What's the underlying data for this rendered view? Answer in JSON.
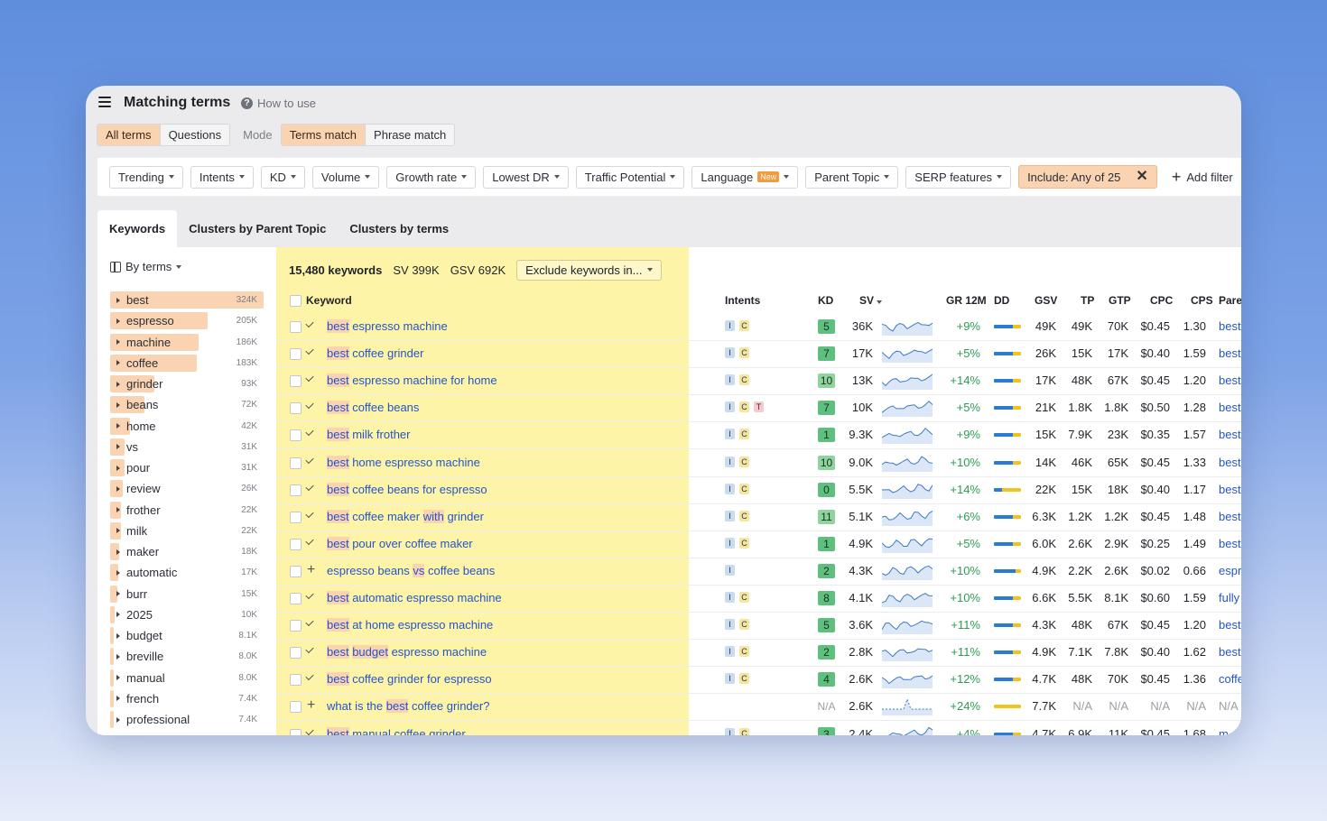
{
  "header": {
    "title": "Matching terms",
    "how_to_use": "How to use"
  },
  "modes": {
    "term_types": [
      "All terms",
      "Questions"
    ],
    "mode_label": "Mode",
    "match_types": [
      "Terms match",
      "Phrase match"
    ]
  },
  "filters": {
    "items": [
      "Trending",
      "Intents",
      "KD",
      "Volume",
      "Growth rate",
      "Lowest DR",
      "Traffic Potential",
      "Language",
      "Parent Topic",
      "SERP features"
    ],
    "new_badge": "New",
    "include": "Include: Any of 25",
    "add_filter": "Add filter"
  },
  "tabs": [
    "Keywords",
    "Clusters by Parent Topic",
    "Clusters by terms"
  ],
  "sidebar": {
    "by_terms": "By terms",
    "terms": [
      {
        "name": "best",
        "count": "324K",
        "share": 1.0
      },
      {
        "name": "espresso",
        "count": "205K",
        "share": 0.633
      },
      {
        "name": "machine",
        "count": "186K",
        "share": 0.574
      },
      {
        "name": "coffee",
        "count": "183K",
        "share": 0.565
      },
      {
        "name": "grinder",
        "count": "93K",
        "share": 0.287
      },
      {
        "name": "beans",
        "count": "72K",
        "share": 0.222
      },
      {
        "name": "home",
        "count": "42K",
        "share": 0.13
      },
      {
        "name": "vs",
        "count": "31K",
        "share": 0.096
      },
      {
        "name": "pour",
        "count": "31K",
        "share": 0.096
      },
      {
        "name": "review",
        "count": "26K",
        "share": 0.08
      },
      {
        "name": "frother",
        "count": "22K",
        "share": 0.068
      },
      {
        "name": "milk",
        "count": "22K",
        "share": 0.068
      },
      {
        "name": "maker",
        "count": "18K",
        "share": 0.056
      },
      {
        "name": "automatic",
        "count": "17K",
        "share": 0.052
      },
      {
        "name": "burr",
        "count": "15K",
        "share": 0.046
      },
      {
        "name": "2025",
        "count": "10K",
        "share": 0.031
      },
      {
        "name": "budget",
        "count": "8.1K",
        "share": 0.025
      },
      {
        "name": "breville",
        "count": "8.0K",
        "share": 0.025
      },
      {
        "name": "manual",
        "count": "8.0K",
        "share": 0.025
      },
      {
        "name": "french",
        "count": "7.4K",
        "share": 0.023
      },
      {
        "name": "professional",
        "count": "7.4K",
        "share": 0.023
      }
    ]
  },
  "summary": {
    "keywords": "15,480 keywords",
    "sv": "SV 399K",
    "gsv": "GSV 692K",
    "exclude": "Exclude keywords in..."
  },
  "table": {
    "columns": [
      "Keyword",
      "Intents",
      "KD",
      "SV",
      "GR 12M",
      "DD",
      "GSV",
      "TP",
      "GTP",
      "CPC",
      "CPS",
      "Pare"
    ],
    "rows": [
      {
        "parts": [
          [
            "best",
            1
          ],
          [
            " espresso machine",
            0
          ]
        ],
        "mark": "check",
        "intents": [
          "I",
          "C"
        ],
        "kd": "5",
        "kdc": "#5fbf7f",
        "sv": "36K",
        "gr": "+9%",
        "dd": 0.7,
        "gsv": "49K",
        "tp": "49K",
        "gtp": "70K",
        "cpc": "$0.45",
        "cps": "1.30",
        "parent": "best"
      },
      {
        "parts": [
          [
            "best",
            1
          ],
          [
            " coffee grinder",
            0
          ]
        ],
        "mark": "check",
        "intents": [
          "I",
          "C"
        ],
        "kd": "7",
        "kdc": "#5fbf7f",
        "sv": "17K",
        "gr": "+5%",
        "dd": 0.7,
        "gsv": "26K",
        "tp": "15K",
        "gtp": "17K",
        "cpc": "$0.40",
        "cps": "1.59",
        "parent": "best"
      },
      {
        "parts": [
          [
            "best",
            1
          ],
          [
            " espresso machine for home",
            0
          ]
        ],
        "mark": "check",
        "intents": [
          "I",
          "C"
        ],
        "kd": "10",
        "kdc": "#8fd39f",
        "sv": "13K",
        "gr": "+14%",
        "dd": 0.7,
        "gsv": "17K",
        "tp": "48K",
        "gtp": "67K",
        "cpc": "$0.45",
        "cps": "1.20",
        "parent": "best"
      },
      {
        "parts": [
          [
            "best",
            1
          ],
          [
            " coffee beans",
            0
          ]
        ],
        "mark": "check",
        "intents": [
          "I",
          "C",
          "T"
        ],
        "kd": "7",
        "kdc": "#5fbf7f",
        "sv": "10K",
        "gr": "+5%",
        "dd": 0.7,
        "gsv": "21K",
        "tp": "1.8K",
        "gtp": "1.8K",
        "cpc": "$0.50",
        "cps": "1.28",
        "parent": "best"
      },
      {
        "parts": [
          [
            "best",
            1
          ],
          [
            " milk frother",
            0
          ]
        ],
        "mark": "check",
        "intents": [
          "I",
          "C"
        ],
        "kd": "1",
        "kdc": "#5fbf7f",
        "sv": "9.3K",
        "gr": "+9%",
        "dd": 0.7,
        "gsv": "15K",
        "tp": "7.9K",
        "gtp": "23K",
        "cpc": "$0.35",
        "cps": "1.57",
        "parent": "best"
      },
      {
        "parts": [
          [
            "best",
            1
          ],
          [
            " home espresso machine",
            0
          ]
        ],
        "mark": "check",
        "intents": [
          "I",
          "C"
        ],
        "kd": "10",
        "kdc": "#8fd39f",
        "sv": "9.0K",
        "gr": "+10%",
        "dd": 0.7,
        "gsv": "14K",
        "tp": "46K",
        "gtp": "65K",
        "cpc": "$0.45",
        "cps": "1.33",
        "parent": "best"
      },
      {
        "parts": [
          [
            "best",
            1
          ],
          [
            " coffee beans for espresso",
            0
          ]
        ],
        "mark": "check",
        "intents": [
          "I",
          "C"
        ],
        "kd": "0",
        "kdc": "#5fbf7f",
        "sv": "5.5K",
        "gr": "+14%",
        "dd": 0.3,
        "gsv": "22K",
        "tp": "15K",
        "gtp": "18K",
        "cpc": "$0.40",
        "cps": "1.17",
        "parent": "best"
      },
      {
        "parts": [
          [
            "best",
            1
          ],
          [
            " coffee maker ",
            0
          ],
          [
            "with",
            1
          ],
          [
            " grinder",
            0
          ]
        ],
        "mark": "check",
        "intents": [
          "I",
          "C"
        ],
        "kd": "11",
        "kdc": "#8fd39f",
        "sv": "5.1K",
        "gr": "+6%",
        "dd": 0.7,
        "gsv": "6.3K",
        "tp": "1.2K",
        "gtp": "1.2K",
        "cpc": "$0.45",
        "cps": "1.48",
        "parent": "best"
      },
      {
        "parts": [
          [
            "best",
            1
          ],
          [
            " pour over coffee maker",
            0
          ]
        ],
        "mark": "check",
        "intents": [
          "I",
          "C"
        ],
        "kd": "1",
        "kdc": "#5fbf7f",
        "sv": "4.9K",
        "gr": "+5%",
        "dd": 0.7,
        "gsv": "6.0K",
        "tp": "2.6K",
        "gtp": "2.9K",
        "cpc": "$0.25",
        "cps": "1.49",
        "parent": "best"
      },
      {
        "parts": [
          [
            "espresso beans ",
            0
          ],
          [
            "vs",
            1
          ],
          [
            " coffee beans",
            0
          ]
        ],
        "mark": "plus",
        "intents": [
          "I"
        ],
        "kd": "2",
        "kdc": "#5fbf7f",
        "sv": "4.3K",
        "gr": "+10%",
        "dd": 0.8,
        "gsv": "4.9K",
        "tp": "2.2K",
        "gtp": "2.6K",
        "cpc": "$0.02",
        "cps": "0.66",
        "parent": "espr"
      },
      {
        "parts": [
          [
            "best",
            1
          ],
          [
            " automatic espresso machine",
            0
          ]
        ],
        "mark": "check",
        "intents": [
          "I",
          "C"
        ],
        "kd": "8",
        "kdc": "#5fbf7f",
        "sv": "4.1K",
        "gr": "+10%",
        "dd": 0.7,
        "gsv": "6.6K",
        "tp": "5.5K",
        "gtp": "8.1K",
        "cpc": "$0.60",
        "cps": "1.59",
        "parent": "fully"
      },
      {
        "parts": [
          [
            "best",
            1
          ],
          [
            " at home espresso machine",
            0
          ]
        ],
        "mark": "check",
        "intents": [
          "I",
          "C"
        ],
        "kd": "5",
        "kdc": "#5fbf7f",
        "sv": "3.6K",
        "gr": "+11%",
        "dd": 0.7,
        "gsv": "4.3K",
        "tp": "48K",
        "gtp": "67K",
        "cpc": "$0.45",
        "cps": "1.20",
        "parent": "best"
      },
      {
        "parts": [
          [
            "best",
            1
          ],
          [
            " ",
            0
          ],
          [
            "budget",
            1
          ],
          [
            " espresso machine",
            0
          ]
        ],
        "mark": "check",
        "intents": [
          "I",
          "C"
        ],
        "kd": "2",
        "kdc": "#5fbf7f",
        "sv": "2.8K",
        "gr": "+11%",
        "dd": 0.7,
        "gsv": "4.9K",
        "tp": "7.1K",
        "gtp": "7.8K",
        "cpc": "$0.40",
        "cps": "1.62",
        "parent": "best"
      },
      {
        "parts": [
          [
            "best",
            1
          ],
          [
            " coffee grinder for espresso",
            0
          ]
        ],
        "mark": "check",
        "intents": [
          "I",
          "C"
        ],
        "kd": "4",
        "kdc": "#5fbf7f",
        "sv": "2.6K",
        "gr": "+12%",
        "dd": 0.7,
        "gsv": "4.7K",
        "tp": "48K",
        "gtp": "70K",
        "cpc": "$0.45",
        "cps": "1.36",
        "parent": "coffe"
      },
      {
        "parts": [
          [
            "what is the ",
            0
          ],
          [
            "best",
            1
          ],
          [
            " coffee grinder?",
            0
          ]
        ],
        "mark": "plus",
        "intents": [],
        "kd": "N/A",
        "kdc": "",
        "sv": "2.6K",
        "gr": "+24%",
        "dd": 0.0,
        "gsv": "7.7K",
        "tp": "N/A",
        "gtp": "N/A",
        "cpc": "N/A",
        "cps": "N/A",
        "parent": "N/A"
      },
      {
        "parts": [
          [
            "best",
            1
          ],
          [
            " manual coffee grinder",
            0
          ]
        ],
        "mark": "check",
        "intents": [
          "I",
          "C"
        ],
        "kd": "3",
        "kdc": "#5fbf7f",
        "sv": "2.4K",
        "gr": "+4%",
        "dd": 0.7,
        "gsv": "4.7K",
        "tp": "6.9K",
        "gtp": "11K",
        "cpc": "$0.45",
        "cps": "1.68",
        "parent": "m"
      }
    ]
  },
  "colors": {
    "accent": "#fad3b3",
    "highlight_column": "#fdf4a8",
    "link": "#2455c8",
    "growth": "#2c9b53"
  }
}
